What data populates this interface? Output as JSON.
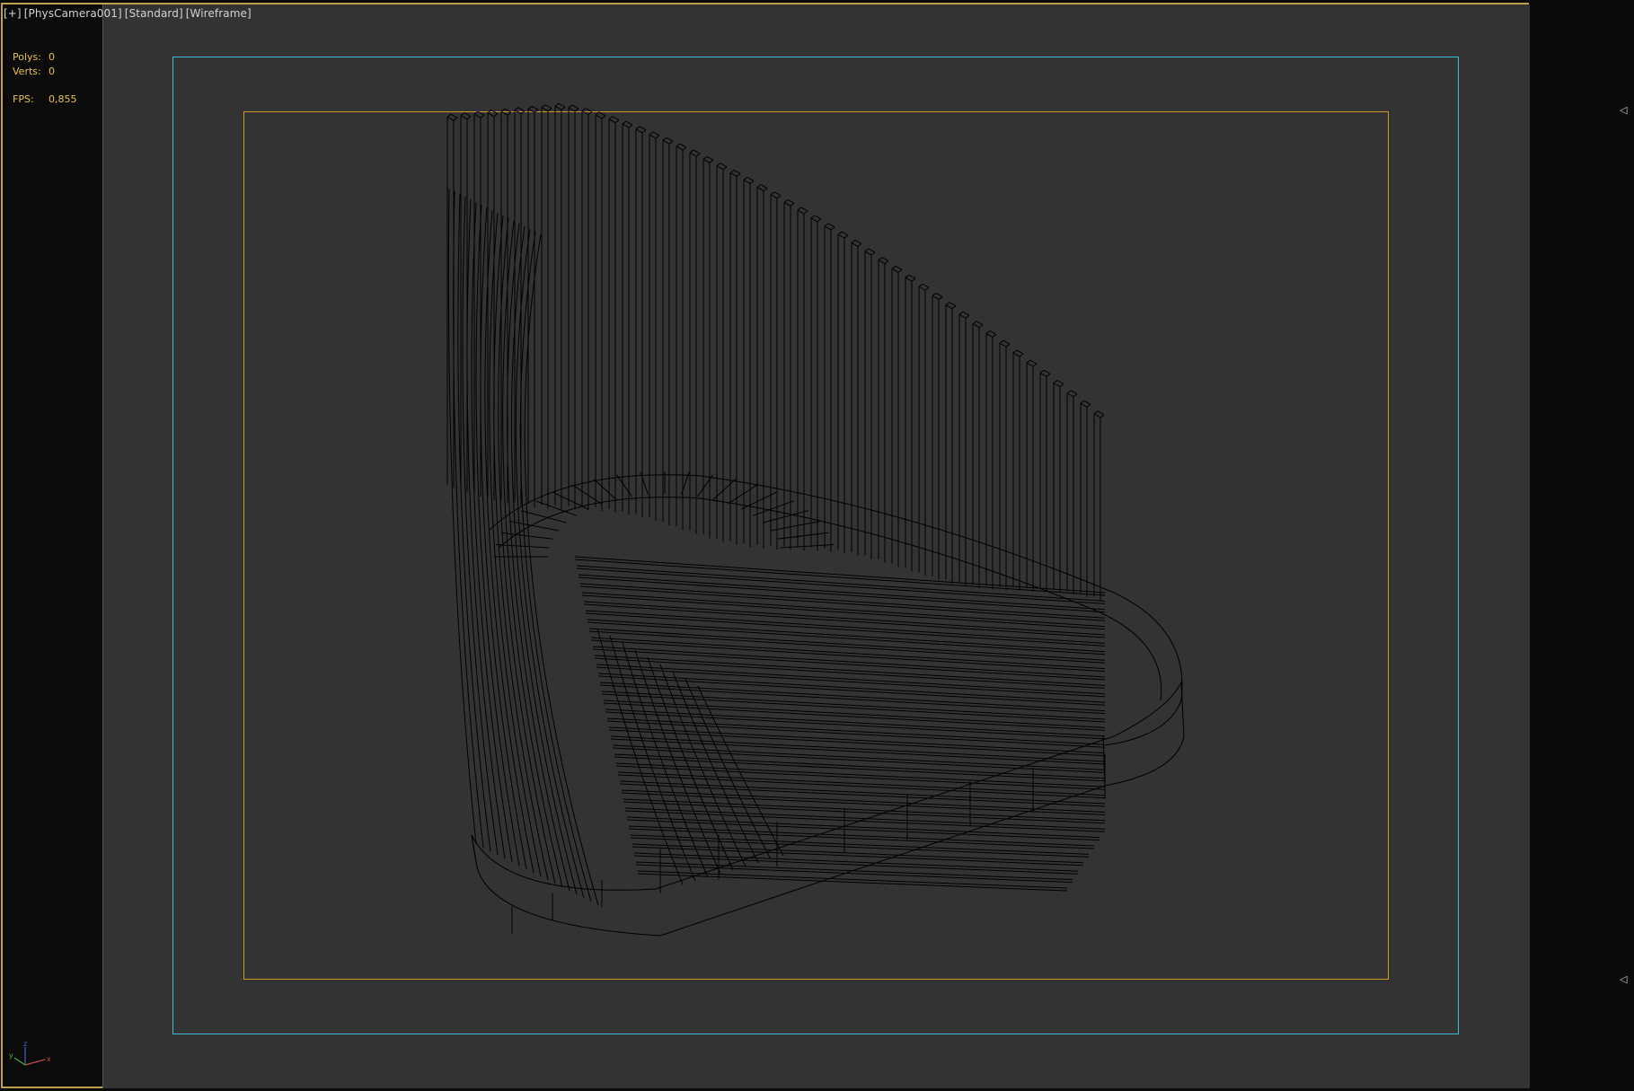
{
  "viewport": {
    "labels": [
      "[+]",
      "[PhysCamera001]",
      "[Standard]",
      "[Wireframe]"
    ]
  },
  "stats": {
    "polys_label": "Polys:",
    "polys_value": "0",
    "verts_label": "Verts:",
    "verts_value": "0",
    "fps_label": "FPS:",
    "fps_value": "0,855"
  },
  "gizmo": {
    "x": "x",
    "y": "y",
    "z": "z"
  },
  "colors": {
    "viewport_bg": "#333333",
    "active_border": "#bda24b",
    "safe_frame": "#3fbdd0",
    "render_frame": "#cf9a2a",
    "stats_text": "#e8c24d"
  },
  "icons": {
    "frame_marker": "triangle-left-icon"
  }
}
